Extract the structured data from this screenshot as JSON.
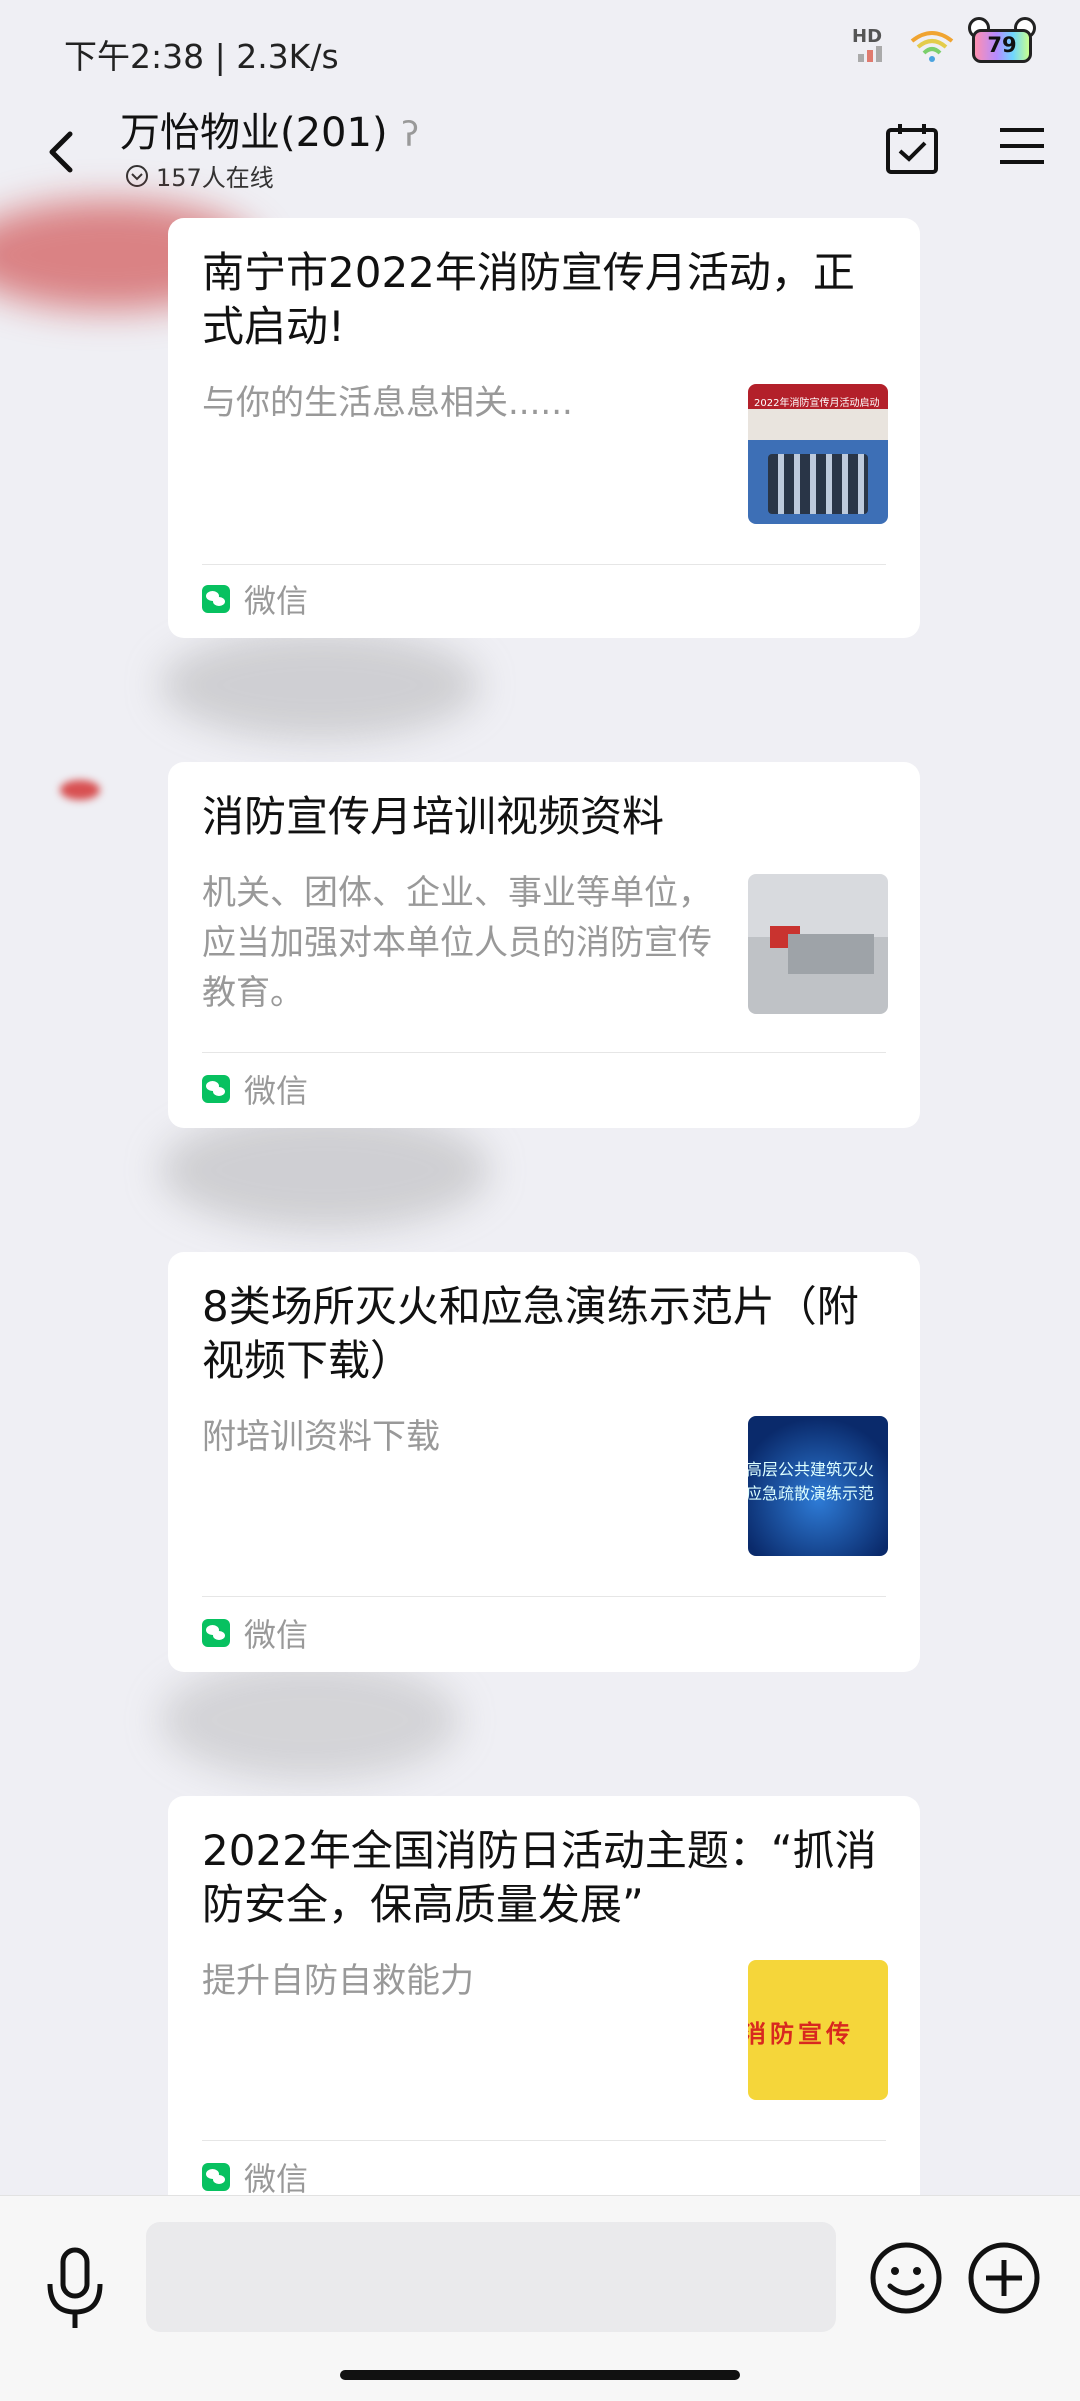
{
  "status_bar": {
    "time_speed": "下午2:38 | 2.3K/s",
    "network_label": "HD",
    "battery": "79"
  },
  "header": {
    "title": "万怡物业(201)",
    "online_count": "157人在线"
  },
  "messages": [
    {
      "title": "南宁市2022年消防宣传月活动，正式启动!",
      "desc": "与你的生活息息相关......",
      "source": "微信",
      "thumb_text": "2022年消防宣传月活动启动"
    },
    {
      "title": "消防宣传月培训视频资料",
      "desc": "机关、团体、企业、事业等单位，应当加强对本单位人员的消防宣传教育。",
      "source": "微信"
    },
    {
      "title": "8类场所灭火和应急演练示范片（附视频下载）",
      "desc": "附培训资料下载",
      "source": "微信",
      "thumb_text_1": "高层公共建筑灭火",
      "thumb_text_2": "应急疏散演练示范"
    },
    {
      "title": "2022年全国消防日活动主题：“抓消防安全，保高质量发展”",
      "desc": "提升自防自救能力",
      "source": "微信",
      "thumb_text": "消防宣传"
    }
  ],
  "input": {
    "value": ""
  },
  "colors": {
    "wechat_green": "#07c160",
    "background": "#efeff4"
  }
}
